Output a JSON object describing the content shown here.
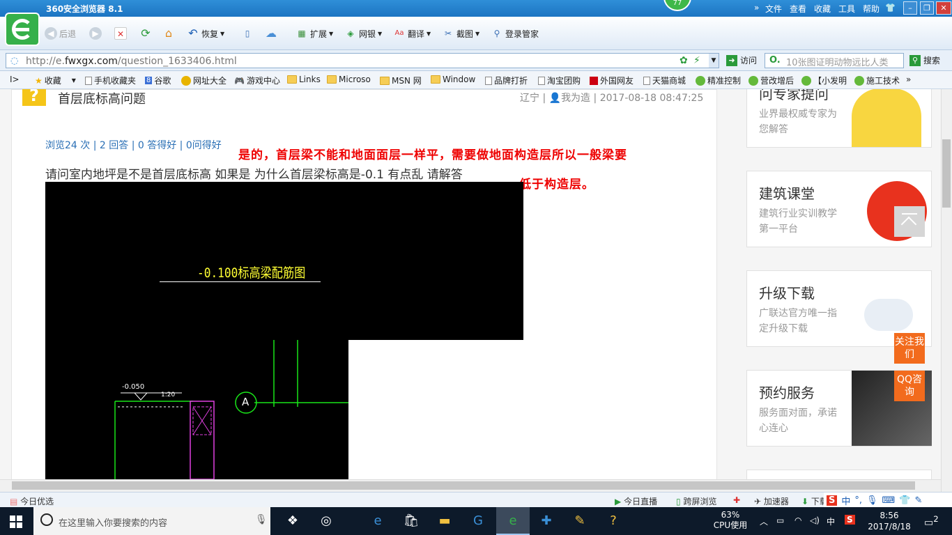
{
  "window": {
    "title": "360安全浏览器 8.1",
    "menu": [
      "文件",
      "查看",
      "收藏",
      "工具",
      "帮助"
    ],
    "weather_badge": "77"
  },
  "toolbar": {
    "back": "后退",
    "restore": "恢复",
    "extensions": "扩展",
    "netbank": "网银",
    "translate": "翻译",
    "screenshot": "截图",
    "login_manager": "登录管家"
  },
  "address": {
    "url_prefix": "http://e.",
    "url_domain": "fwxgx.com",
    "url_path": "/question_1633406.html",
    "go_label": "访问",
    "search_placeholder": "10张图证明动物远比人类",
    "search_button": "搜索"
  },
  "favorites": {
    "items": [
      "收藏",
      "手机收藏夹",
      "谷歌",
      "网址大全",
      "游戏中心",
      "Links",
      "Microso",
      "MSN 网",
      "Window",
      "品牌打折",
      "淘宝团购",
      "外国网友",
      "天猫商城",
      "精准控制",
      "营改增后",
      "【小发明",
      "施工技术"
    ],
    "more": "»"
  },
  "question": {
    "title": "首层底标高问题",
    "location": "辽宁",
    "user": "我为造",
    "datetime": "2017-08-18 08:47:25",
    "stats": "浏览24 次 | 2 回答 | 0 答得好 | 0问得好",
    "body": "请问室内地坪是不是首层底标高 如果是 为什么首层梁标高是-0.1 有点乱 请解答",
    "answer_line1": "是的，首层梁不能和地面面层一样平，需要做地面构造层所以一般梁要",
    "answer_line2": "低于构造层。"
  },
  "drawing": {
    "caption": "-0.100标高梁配筋图",
    "level_mark": "-0.050",
    "small_label": "1:20",
    "axis_label": "A"
  },
  "sidebar": [
    {
      "title": "问专家提问",
      "desc": "业界最权威专家为您解答"
    },
    {
      "title": "建筑课堂",
      "desc": "建筑行业实训教学第一平台"
    },
    {
      "title": "升级下载",
      "desc": "广联达官方唯一指定升级下载"
    },
    {
      "title": "预约服务",
      "desc": "服务面对面，承诺心连心"
    }
  ],
  "float_buttons": {
    "follow": "关注我们",
    "qq": "QQ咨询"
  },
  "statusbar": {
    "today": "今日优选",
    "live": "今日直播",
    "cross_screen": "跨屏浏览",
    "accelerator": "加速器",
    "download": "下载"
  },
  "taskbar": {
    "search_placeholder": "在这里输入你要搜索的内容",
    "cpu_percent": "63%",
    "cpu_label": "CPU使用",
    "ime": "中",
    "time": "8:56",
    "date": "2017/8/18",
    "notifications": "2"
  },
  "colors": {
    "titlebar": "#1c74c2",
    "answer_text": "#e00000",
    "stats_link": "#2a6fb5",
    "accent_orange": "#f26b1d",
    "logo_green": "#36b04a"
  }
}
